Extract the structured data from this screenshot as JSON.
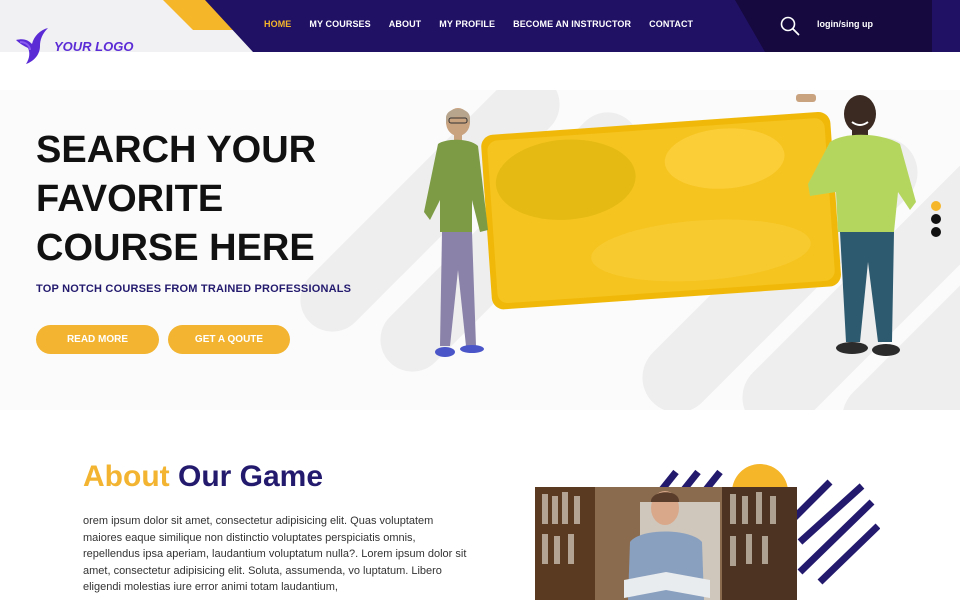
{
  "brand": {
    "logo_text": "YOUR LOGO",
    "accent": "#f5b62a",
    "nav_bg": "#211165",
    "title_color": "#231a6e"
  },
  "nav": {
    "items": [
      {
        "label": "HOME",
        "active": true
      },
      {
        "label": "MY COURSES",
        "active": false
      },
      {
        "label": "ABOUT",
        "active": false
      },
      {
        "label": "MY PROFILE",
        "active": false
      },
      {
        "label": "BECOME AN INSTRUCTOR",
        "active": false
      },
      {
        "label": "CONTACT",
        "active": false
      }
    ],
    "search_icon": "search-icon",
    "login_label": "login/sing up"
  },
  "hero": {
    "title": "SEARCH YOUR FAVORITE COURSE HERE",
    "subtitle": "TOP NOTCH COURSES FROM TRAINED PROFESSIONALS",
    "read_more": "READ MORE",
    "quote": "GET A QOUTE",
    "slides": 3,
    "active_slide": 1
  },
  "about": {
    "title_part1": "About",
    "title_part2": "Our Game",
    "body": "orem ipsum dolor sit amet, consectetur adipisicing elit. Quas voluptatem maiores eaque similique non distinctio voluptates perspiciatis omnis, repellendus ipsa aperiam, laudantium voluptatum nulla?. Lorem ipsum dolor sit amet, consectetur adipisicing elit. Soluta, assumenda, vo luptatum. Libero eligendi molestias iure error animi totam laudantium,"
  }
}
